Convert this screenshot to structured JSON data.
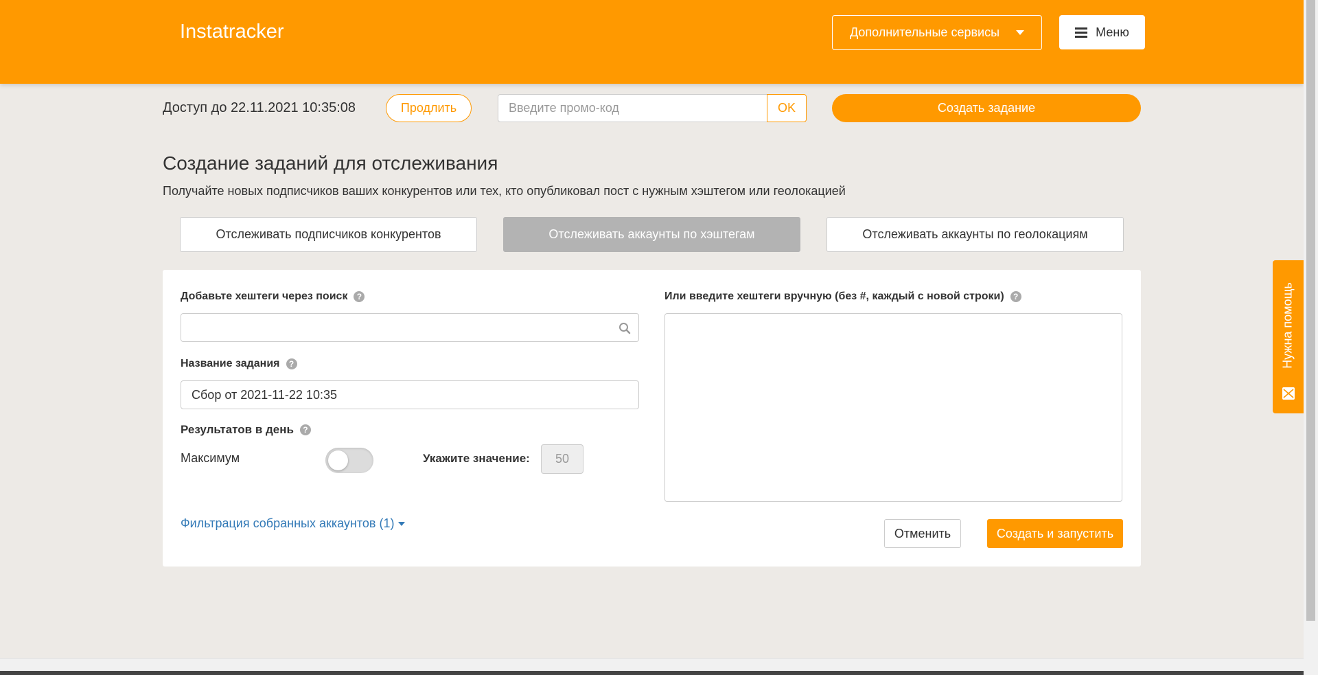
{
  "header": {
    "brand": "Instatracker",
    "services_label": "Дополнительные сервисы",
    "menu_label": "Меню"
  },
  "topbar": {
    "access_text": "Доступ до 22.11.2021 10:35:08",
    "prolong_label": "Продлить",
    "promo_placeholder": "Введите промо-код",
    "ok_label": "OK",
    "create_task_label": "Создать задание"
  },
  "page": {
    "title": "Создание заданий для отслеживания",
    "subtitle": "Получайте новых подписчиков ваших конкурентов или тех, кто опубликовал пост с нужным хэштегом или геолокацией"
  },
  "tabs": [
    {
      "label": "Отслеживать подписчиков конкурентов",
      "active": false
    },
    {
      "label": "Отслеживать аккаунты по хэштегам",
      "active": true
    },
    {
      "label": "Отслеживать аккаунты по геолокациям",
      "active": false
    }
  ],
  "form": {
    "search_label": "Добавьте хештеги через поиск",
    "search_value": "",
    "task_name_label": "Название задания",
    "task_name_value": "Сбор от 2021-11-22 10:35",
    "results_label": "Результатов в день",
    "maximum_label": "Максимум",
    "maximum_enabled": false,
    "value_label": "Укажите значение:",
    "value": "50",
    "filter_link": "Фильтрация собранных аккаунтов (1)",
    "manual_label": "Или введите хештеги вручную (без #, каждый с новой строки)",
    "manual_value": "",
    "help_glyph": "?",
    "cancel_label": "Отменить",
    "start_label": "Создать и запустить"
  },
  "help_widget": {
    "label": "Нужна помощь"
  },
  "colors": {
    "accent": "#ff9900",
    "background": "#edeae6",
    "link": "#337ab7",
    "active_tab": "#b3b3b3"
  },
  "icons": [
    "caret-down-icon",
    "hamburger-icon",
    "help-icon",
    "search-icon",
    "envelope-icon"
  ]
}
